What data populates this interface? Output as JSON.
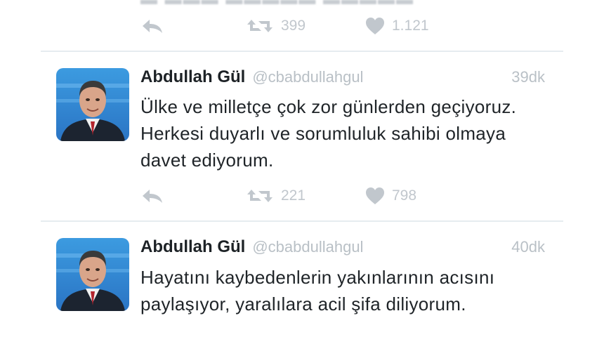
{
  "top_tweet": {
    "retweets": "399",
    "likes": "1.121"
  },
  "tweets": [
    {
      "name": "Abdullah Gül",
      "handle": "@cbabdullahgul",
      "time": "39dk",
      "text": "Ülke ve milletçe çok zor günlerden geçiyoruz. Herkesi duyarlı ve sorumluluk sahibi olmaya davet ediyorum.",
      "retweets": "221",
      "likes": "798"
    },
    {
      "name": "Abdullah Gül",
      "handle": "@cbabdullahgul",
      "time": "40dk",
      "text": "Hayatını kaybedenlerin yakınlarının acısını paylaşıyor, yaralılara acil şifa diliyorum."
    }
  ],
  "icons": {
    "reply": "reply-icon",
    "retweet": "retweet-icon",
    "like": "heart-icon"
  },
  "colors": {
    "text": "#1f2428",
    "muted": "#b9c0c6",
    "icon": "#c1c7cd",
    "divider": "#e6ecf0"
  }
}
